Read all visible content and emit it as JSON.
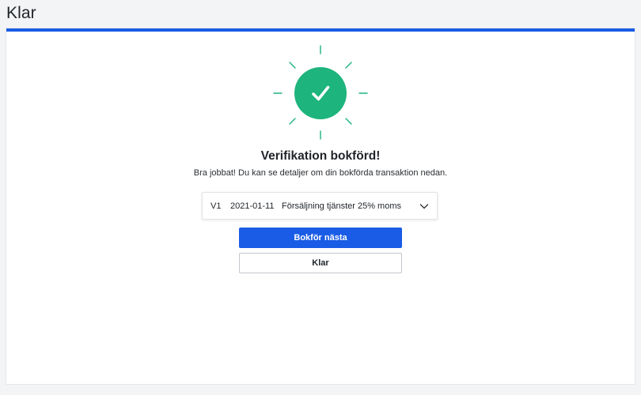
{
  "page": {
    "title": "Klar"
  },
  "confirmation": {
    "heading": "Verifikation bokförd!",
    "message": "Bra jobbat! Du kan se detaljer om din bokförda transaktion nedan."
  },
  "verification": {
    "number": "V1",
    "date": "2021-01-11",
    "description": "Försäljning tjänster 25% moms"
  },
  "actions": {
    "next_label": "Bokför nästa",
    "done_label": "Klar"
  },
  "colors": {
    "accent": "#1a5ce5",
    "success": "#1db47d"
  },
  "icons": {
    "success": "checkmark-icon",
    "expand": "chevron-down-icon"
  }
}
